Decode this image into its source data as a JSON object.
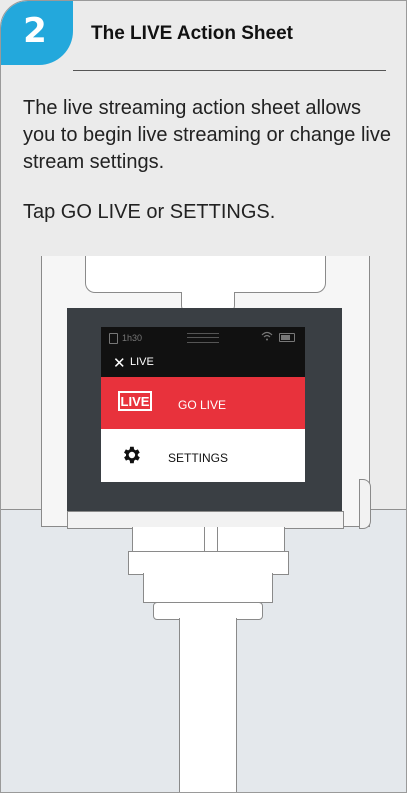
{
  "step": {
    "number": "2",
    "title": "The LIVE Action Sheet"
  },
  "body": {
    "description": "The live streaming action sheet allows you to begin live streaming or change live stream settings.",
    "instruction": "Tap GO LIVE or SETTINGS."
  },
  "screen": {
    "status": {
      "recording_time": "1h30",
      "icons": [
        "sd-card-icon",
        "wifi-icon",
        "battery-icon"
      ]
    },
    "header": {
      "close_glyph": "✕",
      "title": "LIVE"
    },
    "go_live": {
      "badge": "LIVE",
      "label": "GO LIVE",
      "color": "#e8323c"
    },
    "settings": {
      "label": "SETTINGS",
      "icon": "gear-icon"
    }
  },
  "colors": {
    "accent": "#23a8dc",
    "live_red": "#e8323c"
  }
}
